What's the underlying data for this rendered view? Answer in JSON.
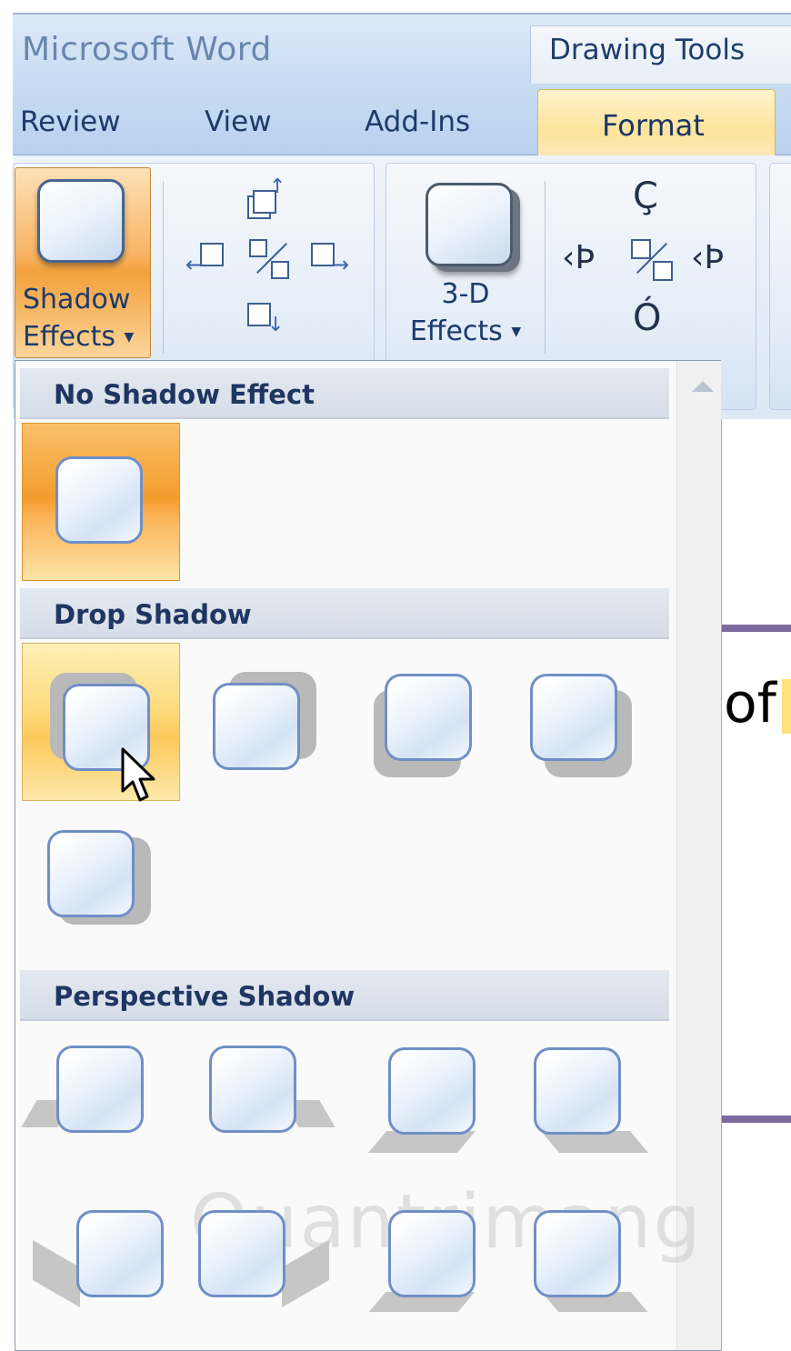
{
  "title_bar": {
    "app_title": "Microsoft Word",
    "context_tab": "Drawing Tools"
  },
  "tabs": [
    {
      "label": "Review"
    },
    {
      "label": "View"
    },
    {
      "label": "Add-Ins"
    },
    {
      "label": "Format",
      "active": true
    }
  ],
  "ribbon": {
    "shadow_button": {
      "line1": "Shadow",
      "line2": "Effects",
      "dropdown_icon": "triangle-down"
    },
    "threed_button": {
      "line1": "3-D",
      "line2": "Effects",
      "dropdown_icon": "triangle-down"
    },
    "shadow_nudge_icons": [
      "nudge-up-icon",
      "nudge-left-icon",
      "shadow-toggle-icon",
      "nudge-right-icon",
      "nudge-down-icon"
    ],
    "tilt_icons": [
      "tilt-up-icon",
      "tilt-left-icon",
      "3d-toggle-icon",
      "tilt-right-icon",
      "tilt-down-icon"
    ]
  },
  "gallery": {
    "sections": [
      {
        "title": "No Shadow Effect"
      },
      {
        "title": "Drop Shadow"
      },
      {
        "title": "Perspective Shadow"
      }
    ]
  },
  "document": {
    "visible_text": "of"
  },
  "watermark": "Quantrimang",
  "colors": {
    "selected": "#f49c2d",
    "hover": "#fdd97a",
    "accent_text": "#1f3562"
  }
}
